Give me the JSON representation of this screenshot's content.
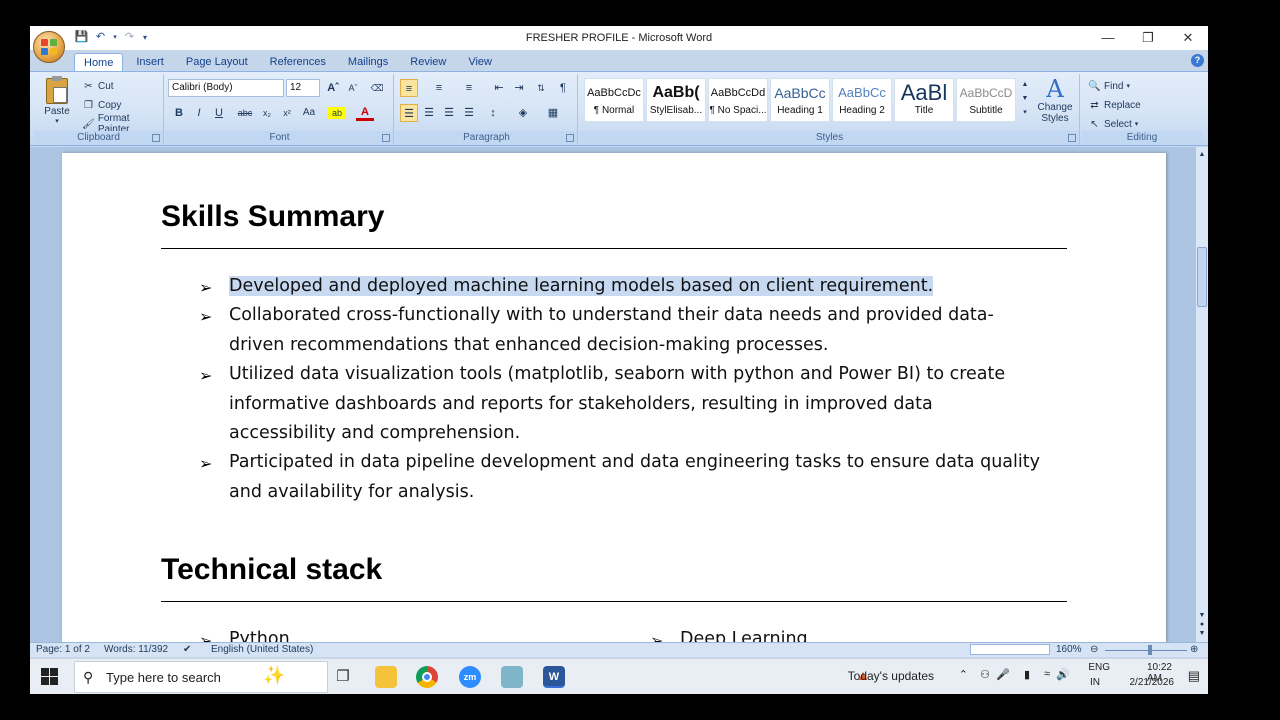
{
  "window": {
    "title": "FRESHER PROFILE - Microsoft Word",
    "controls": [
      "minimize",
      "restore",
      "close"
    ]
  },
  "ribbon": {
    "tabs": [
      "Home",
      "Insert",
      "Page Layout",
      "References",
      "Mailings",
      "Review",
      "View"
    ],
    "active_tab": "Home",
    "clipboard": {
      "label": "Clipboard",
      "paste": "Paste",
      "cut": "Cut",
      "copy": "Copy",
      "format_painter": "Format Painter"
    },
    "font": {
      "label": "Font",
      "font_name": "Calibri (Body)",
      "font_size": "12"
    },
    "paragraph": {
      "label": "Paragraph"
    },
    "styles": {
      "label": "Styles",
      "items": [
        {
          "preview": "AaBbCcDc",
          "name": "¶ Normal"
        },
        {
          "preview": "AaBb(",
          "name": "StylElisab..."
        },
        {
          "preview": "AaBbCcDd",
          "name": "¶ No Spaci..."
        },
        {
          "preview": "AaBbCc",
          "name": "Heading 1"
        },
        {
          "preview": "AaBbCc",
          "name": "Heading 2"
        },
        {
          "preview": "AaBl",
          "name": "Title"
        },
        {
          "preview": "AaBbCcD",
          "name": "Subtitle"
        }
      ],
      "change_styles": "Change Styles"
    },
    "editing": {
      "label": "Editing",
      "find": "Find",
      "replace": "Replace",
      "select": "Select"
    }
  },
  "document": {
    "section1_heading": "Skills Summary",
    "bullets": [
      {
        "lines": [
          "Developed and deployed machine learning models based on client requirement."
        ],
        "selected": true
      },
      {
        "lines": [
          "Collaborated cross-functionally with to understand their data needs and provided data-",
          "driven recommendations that enhanced decision-making processes."
        ]
      },
      {
        "lines": [
          "Utilized data visualization tools (matplotlib, seaborn with python and Power BI) to create",
          "informative dashboards and reports for stakeholders, resulting in improved data",
          "accessibility and comprehension."
        ]
      },
      {
        "lines": [
          "Participated in data pipeline development and data engineering tasks to ensure data quality",
          "and availability for analysis."
        ]
      }
    ],
    "section2_heading": "Technical stack",
    "tech_left": "Python",
    "tech_right": "Deep Learning"
  },
  "statusbar": {
    "page": "Page: 1 of 2",
    "words": "Words: 11/392",
    "language": "English (United States)",
    "zoom": "160%"
  },
  "taskbar": {
    "search_placeholder": "Type here to search",
    "news": "Today's updates",
    "lang_top": "ENG",
    "lang_bottom": "IN",
    "time": "10:22 AM",
    "date": "2/21/2026"
  },
  "colors": {
    "selection": "#c6d9f0",
    "ribbon": "#d4e3f5",
    "tab_text": "#15428b"
  }
}
